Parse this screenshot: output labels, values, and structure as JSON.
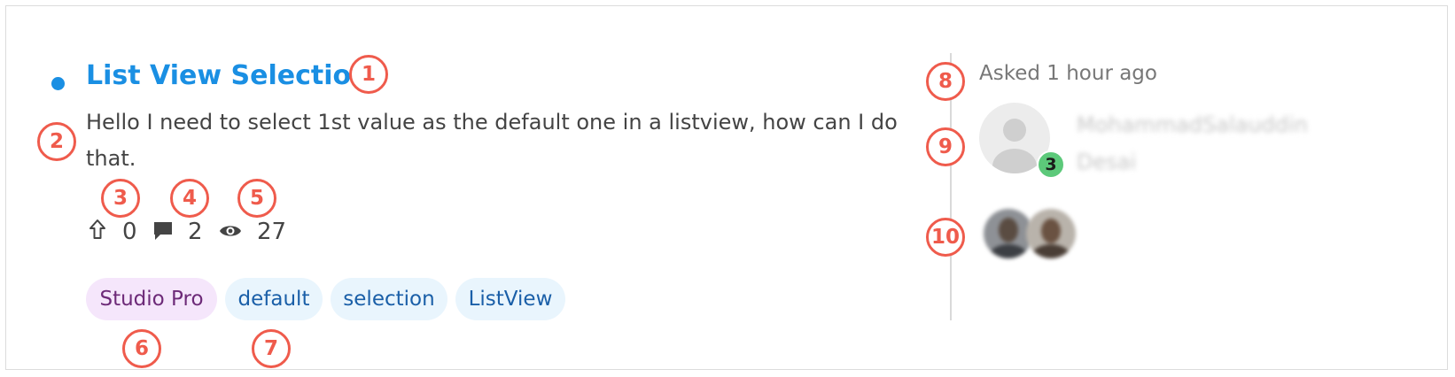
{
  "question": {
    "title": "List View Selection",
    "body": "Hello I need to select 1st value as the default one in a listview, how can I do that.",
    "stats": {
      "upvotes": "0",
      "comments": "2",
      "views": "27"
    },
    "tags": [
      {
        "label": "Studio Pro",
        "kind": "product"
      },
      {
        "label": "default",
        "kind": "tag"
      },
      {
        "label": "selection",
        "kind": "tag"
      },
      {
        "label": "ListView",
        "kind": "tag"
      }
    ]
  },
  "meta": {
    "asked": "Asked 1 hour ago",
    "author_name": "MohammadSalauddin Desai",
    "author_badge": "3"
  },
  "markers": [
    "1",
    "2",
    "3",
    "4",
    "5",
    "6",
    "7",
    "8",
    "9",
    "10"
  ],
  "icons": {
    "upvote": "upvote-arrow-icon",
    "comments": "comment-icon",
    "views": "eye-icon"
  },
  "colors": {
    "title": "#1a8fe3",
    "unread_dot": "#1a8fe3",
    "marker": "#ef5b4c",
    "badge": "#5cc97a",
    "product_tag_bg": "#f5e6fb",
    "tag_bg": "#e9f5fd"
  }
}
